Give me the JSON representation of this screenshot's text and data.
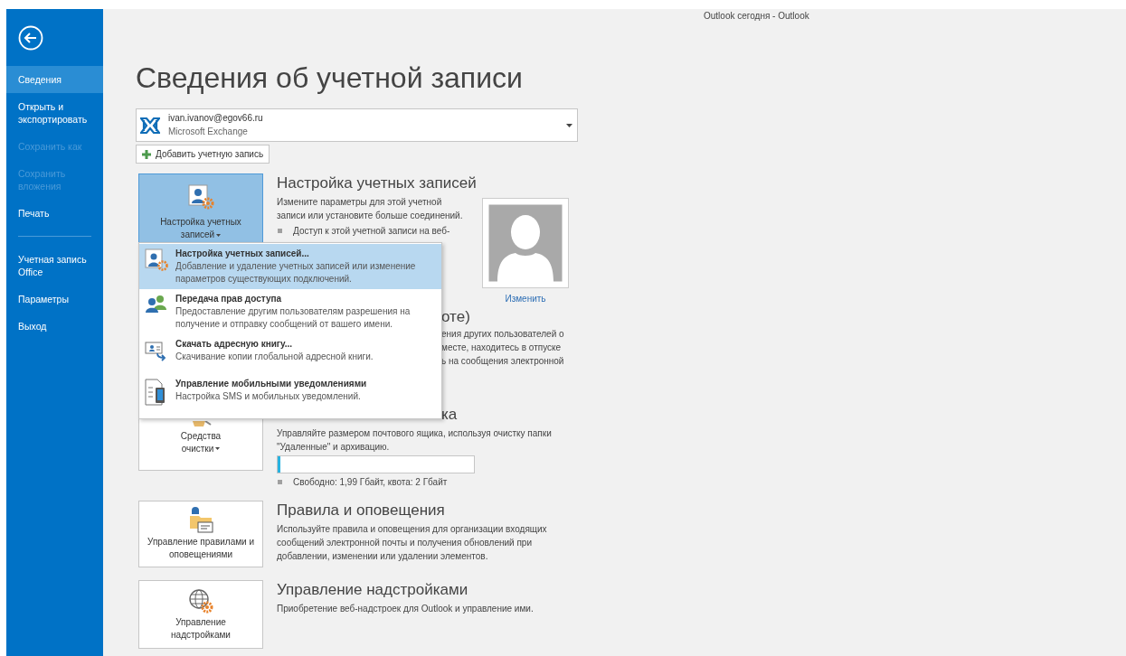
{
  "window": {
    "title": "Outlook сегодня - Outlook"
  },
  "sidebar": {
    "items": [
      {
        "label": "Сведения",
        "selected": true,
        "disabled": false
      },
      {
        "label": "Открыть и экспортировать",
        "selected": false,
        "disabled": false
      },
      {
        "label": "Сохранить как",
        "selected": false,
        "disabled": true
      },
      {
        "label": "Сохранить вложения",
        "selected": false,
        "disabled": true
      },
      {
        "label": "Печать",
        "selected": false,
        "disabled": false,
        "divider_after": true
      },
      {
        "label": "Учетная запись Office",
        "selected": false,
        "disabled": false
      },
      {
        "label": "Параметры",
        "selected": false,
        "disabled": false
      },
      {
        "label": "Выход",
        "selected": false,
        "disabled": false
      }
    ]
  },
  "page_title": "Сведения об учетной записи",
  "account": {
    "email": "ivan.ivanov@egov66.ru",
    "type": "Microsoft Exchange"
  },
  "add_account_button": "Добавить учетную запись",
  "sections": [
    {
      "kind": "settings",
      "button": "Настройка учетных записей",
      "button_pressed": true,
      "heading": "Настройка учетных записей",
      "text": "Измените параметры для этой учетной записи или установите больше соединений.",
      "bullets": [
        "Доступ к этой учетной записи на веб-"
      ],
      "photo_link": "Изменить"
    },
    {
      "kind": "covered",
      "heading": "оте)",
      "lines": [
        "ения других пользователей о",
        "месте, находитесь в отпуске",
        "ь на сообщения электронной"
      ]
    },
    {
      "kind": "cleanup",
      "button": "Средства очистки",
      "button_pressed": false,
      "heading": "ка",
      "text": "Управляйте размером почтового ящика, используя очистку папки \"Удаленные\" и архивацию.",
      "level": 0.01,
      "bullets": [
        "Свободно: 1,99 Гбайт, квота: 2 Гбайт"
      ]
    },
    {
      "kind": "rules",
      "button": "Управление правилами и оповещениями",
      "button_pressed": false,
      "heading": "Правила и оповещения",
      "text": "Используйте правила и оповещения для организации входящих сообщений электронной почты и получения обновлений при добавлении, изменении или удалении элементов."
    },
    {
      "kind": "addins",
      "button": "Управление надстройками",
      "button_pressed": false,
      "heading": "Управление надстройками",
      "text": "Приобретение веб-надстроек для Outlook и управление ими."
    }
  ],
  "menu": {
    "items": [
      {
        "kind": "account",
        "title": "Настройка учетных записей...",
        "text": "Добавление и удаление учетных записей или изменение параметров существующих подключений.",
        "selected": true
      },
      {
        "kind": "delegate",
        "title": "Передача прав доступа",
        "text": "Предоставление другим пользователям разрешения на получение и отправку сообщений от вашего имени.",
        "selected": false
      },
      {
        "kind": "addressbook",
        "title": "Скачать адресную книгу...",
        "text": "Скачивание копии глобальной адресной книги.",
        "selected": false
      },
      {
        "kind": "mobile",
        "title": "Управление мобильными уведомлениями",
        "text": "Настройка SMS и мобильных уведомлений.",
        "selected": false
      }
    ]
  }
}
